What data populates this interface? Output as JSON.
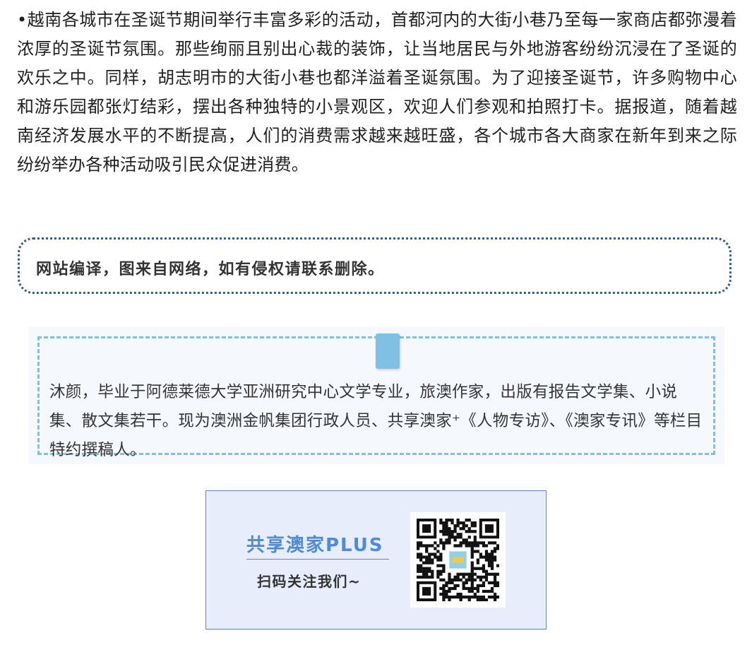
{
  "article": {
    "paragraph": "•越南各城市在圣诞节期间举行丰富多彩的活动，首都河内的大街小巷乃至每一家商店都弥漫着浓厚的圣诞节氛围。那些绚丽且别出心裁的装饰，让当地居民与外地游客纷纷沉浸在了圣诞的欢乐之中。同样，胡志明市的大街小巷也都洋溢着圣诞氛围。为了迎接圣诞节，许多购物中心和游乐园都张灯结彩，摆出各种独特的小景观区，欢迎人们参观和拍照打卡。据报道，随着越南经济发展水平的不断提高，人们的消费需求越来越旺盛，各个城市各大商家在新年到来之际纷纷举办各种活动吸引民众促进消费。"
  },
  "notice": {
    "text": "网站编译，图来自网络，如有侵权请联系删除。"
  },
  "author": {
    "bio": "沐颜，毕业于阿德莱德大学亚洲研究中心文学专业，旅澳作家，出版有报告文学集、小说集、散文集若干。现为澳洲金帆集团行政人员、共享澳家⁺《人物专访》、《澳家专讯》等栏目特约撰稿人。"
  },
  "promo": {
    "title": "共享澳家PLUS",
    "subtitle": "扫码关注我们~",
    "qr_icon": "qr-code-icon",
    "colors": {
      "title": "#4f8bd8",
      "card_bg": "#e7edfb",
      "border": "#5f86c9"
    }
  }
}
